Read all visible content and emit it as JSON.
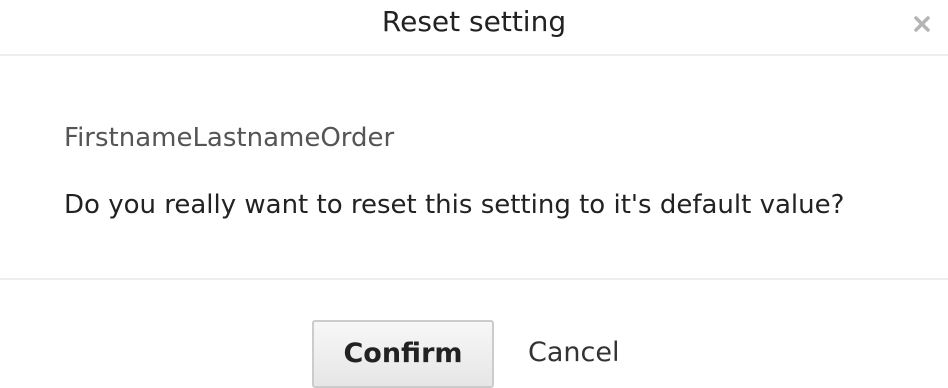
{
  "dialog": {
    "title": "Reset setting",
    "close_icon": "close-icon",
    "setting_name": "FirstnameLastnameOrder",
    "question": "Do you really want to reset this setting to it's default value?",
    "confirm_label": "Confirm",
    "cancel_label": "Cancel"
  },
  "colors": {
    "divider": "#eeeeee",
    "button_border": "#cccccc",
    "muted_text": "#555555",
    "close_icon": "#b5b5b5"
  }
}
